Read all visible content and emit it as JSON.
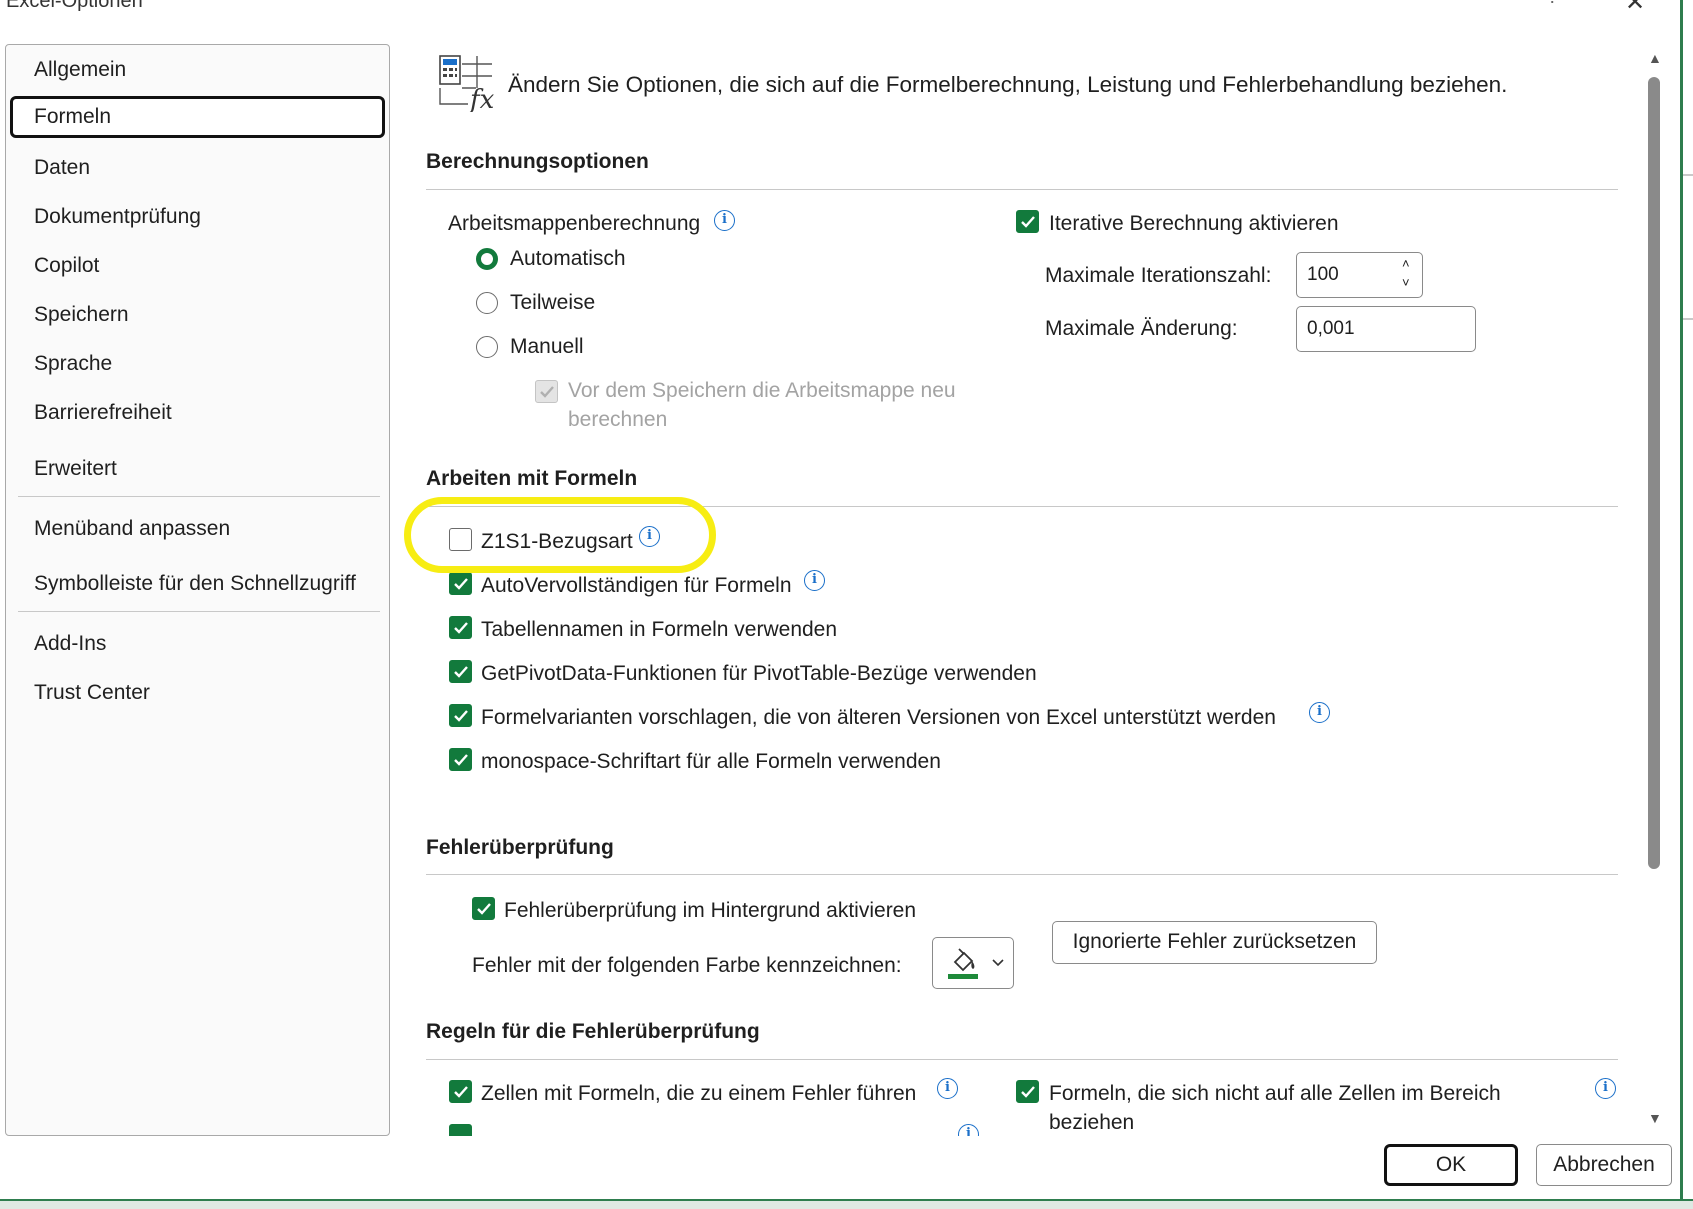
{
  "window": {
    "title": "Excel-Optionen",
    "help_icon": "question-mark-icon",
    "close_icon": "close-icon"
  },
  "sidebar": {
    "items": [
      {
        "label": "Allgemein"
      },
      {
        "label": "Formeln"
      },
      {
        "label": "Daten"
      },
      {
        "label": "Dokumentprüfung"
      },
      {
        "label": "Copilot"
      },
      {
        "label": "Speichern"
      },
      {
        "label": "Sprache"
      },
      {
        "label": "Barrierefreiheit"
      },
      {
        "label": "Erweitert"
      },
      {
        "label": "Menüband anpassen"
      },
      {
        "label": "Symbolleiste für den Schnellzugriff"
      },
      {
        "label": "Add-Ins"
      },
      {
        "label": "Trust Center"
      }
    ],
    "selected": "Formeln"
  },
  "header": {
    "text": "Ändern Sie Optionen, die sich auf die Formelberechnung, Leistung und Fehlerbehandlung beziehen.",
    "icon": "formula-calculator-icon"
  },
  "calc": {
    "title": "Berechnungsoptionen",
    "workbook_label": "Arbeitsmappenberechnung",
    "radio_auto": "Automatisch",
    "radio_partial": "Teilweise",
    "radio_manual": "Manuell",
    "recalc_before_save_line1": "Vor dem Speichern die Arbeitsmappe neu",
    "recalc_before_save_line2": "berechnen",
    "iterative_label": "Iterative Berechnung aktivieren",
    "max_iter_label": "Maximale Iterationszahl:",
    "max_iter_value": "100",
    "max_change_label": "Maximale Änderung:",
    "max_change_value": "0,001"
  },
  "formulas": {
    "title": "Arbeiten mit Formeln",
    "r1c1_label": "Z1S1-Bezugsart",
    "autocomplete_label": "AutoVervollständigen für Formeln",
    "table_names_label": "Tabellennamen in Formeln verwenden",
    "getpivot_label": "GetPivotData-Funktionen für PivotTable-Bezüge verwenden",
    "variants_label": "Formelvarianten vorschlagen, die von älteren Versionen von Excel unterstützt werden",
    "monospace_label": "monospace-Schriftart für alle Formeln verwenden"
  },
  "errors": {
    "title": "Fehlerüberprüfung",
    "background_label": "Fehlerüberprüfung im Hintergrund aktivieren",
    "color_label": "Fehler mit der folgenden Farbe kennzeichnen:",
    "reset_button": "Ignorierte Fehler zurücksetzen",
    "color_icon": "paint-bucket-icon",
    "color_value": "#1e8a3a"
  },
  "rules": {
    "title": "Regeln für die Fehlerüberprüfung",
    "cells_error_label": "Zellen mit Formeln, die zu einem Fehler führen",
    "not_all_cells_line1": "Formeln, die sich nicht auf alle Zellen im Bereich",
    "not_all_cells_line2": "beziehen"
  },
  "footer": {
    "ok": "OK",
    "cancel": "Abbrechen"
  },
  "colors": {
    "accent": "#127a3c",
    "info": "#1a6fc9",
    "highlight": "#f7ed13"
  }
}
